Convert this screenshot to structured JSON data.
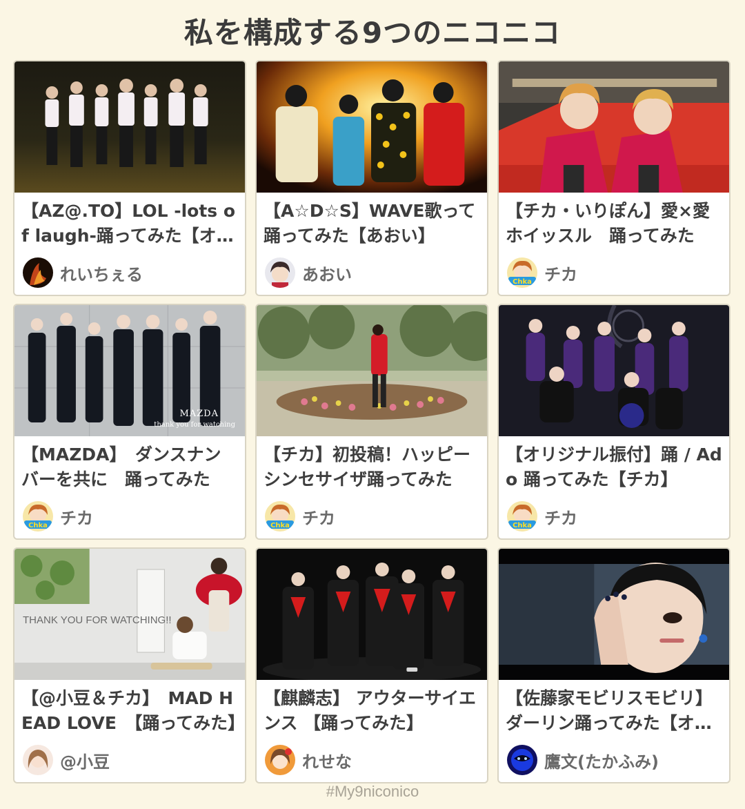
{
  "title": "私を構成する9つのニコニコ",
  "hashtag": "#My9niconico",
  "cards": [
    {
      "title": "【AZ@.TO】LOL -lots of laugh-踊ってみた【オリジナル振付】",
      "author": "れいちぇる",
      "thumbnail_icon": "group-dance-photo",
      "avatar_icon": "dark-fire-avatar"
    },
    {
      "title": "【A☆D☆S】WAVE歌って踊ってみた【あおい】",
      "author": "あおい",
      "thumbnail_icon": "group-dance-photo",
      "avatar_icon": "anime-avatar"
    },
    {
      "title": "【チカ・いりぽん】愛×愛ホイッスル　踊ってみた",
      "author": "チカ",
      "thumbnail_icon": "duo-photo",
      "avatar_icon": "chika-avatar"
    },
    {
      "title": "【MAZDA】　ダンスナンバーを共に　踊ってみた",
      "author": "チカ",
      "thumbnail_icon": "group-dance-photo",
      "thumbnail_caption": "MAZDA",
      "thumbnail_subcaption": "thank you for watching",
      "avatar_icon": "chika-avatar"
    },
    {
      "title": "【チカ】初投稿！ハッピーシンセサイザ踊ってみた",
      "author": "チカ",
      "thumbnail_icon": "park-dance-photo",
      "avatar_icon": "chika-avatar"
    },
    {
      "title": "【オリジナル振付】踊 / Ado 踊ってみた【チカ】",
      "author": "チカ",
      "thumbnail_icon": "studio-dance-photo",
      "avatar_icon": "chika-avatar"
    },
    {
      "title": "【@小豆＆チカ】　MAD HEAD LOVE　【踊ってみた】",
      "author": "@小豆",
      "thumbnail_icon": "room-photo",
      "thumbnail_caption": "THANK YOU FOR WATCHING!!",
      "avatar_icon": "girl-avatar"
    },
    {
      "title": "【麒麟志】 アウターサイエンス 【踊ってみた】",
      "author": "れせな",
      "thumbnail_icon": "stage-dance-photo",
      "avatar_icon": "anime-girl-avatar"
    },
    {
      "title": "【佐藤家モビリスモビリ】ダーリン踊ってみた【オリジナル振付】",
      "author": "鷹文(たかふみ)",
      "thumbnail_icon": "closeup-photo",
      "avatar_icon": "blue-mask-avatar"
    }
  ],
  "colors": {
    "background": "#fbf6e4",
    "card_border": "#d9d4c3",
    "title_text": "#3e3e3e",
    "author_text": "#6a6a6a"
  }
}
